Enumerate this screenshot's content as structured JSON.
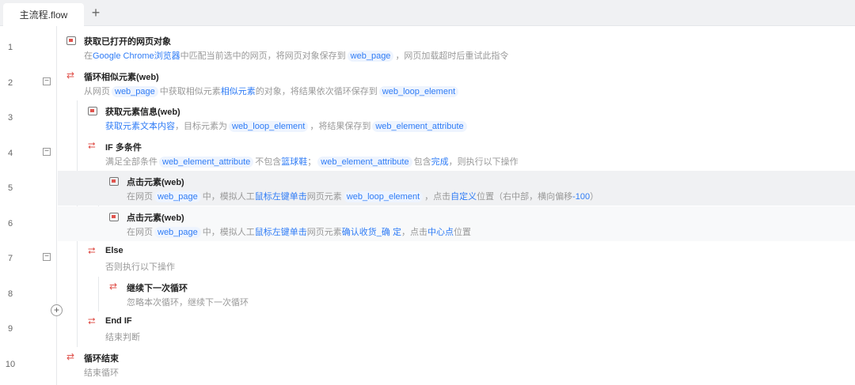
{
  "tab": {
    "label": "主流程.flow",
    "add": "+"
  },
  "line_numbers": [
    "1",
    "2",
    "3",
    "4",
    "5",
    "6",
    "7",
    "8",
    "9",
    "10"
  ],
  "collapse_symbol": "−",
  "add_step": "+",
  "rows": [
    {
      "level": 0,
      "icon": "browser-icon",
      "title": "获取已打开的网页对象",
      "desc": [
        [
          "在",
          ""
        ],
        [
          "Google Chrome浏览器",
          "h"
        ],
        [
          "中匹配当前选中的网页，将网页对象保存到",
          ""
        ],
        [
          "web_page",
          "v"
        ],
        [
          "，网页加载超时后重试此指令",
          ""
        ]
      ]
    },
    {
      "level": 0,
      "icon": "loop-icon",
      "title": "循环相似元素(web)",
      "desc": [
        [
          "从网页",
          ""
        ],
        [
          "web_page",
          "v"
        ],
        [
          "中获取相似元素",
          ""
        ],
        [
          "相似元素",
          "h"
        ],
        [
          "的对象，将结果依次循环保存到",
          ""
        ],
        [
          "web_loop_element",
          "v"
        ]
      ]
    },
    {
      "level": 1,
      "icon": "element-info-icon",
      "title": "获取元素信息(web)",
      "desc": [
        [
          "获取元素文本内容",
          "h"
        ],
        [
          "，目标元素为",
          ""
        ],
        [
          "web_loop_element",
          "v"
        ],
        [
          "，将结果保存到",
          ""
        ],
        [
          "web_element_attribute",
          "v"
        ]
      ]
    },
    {
      "level": 1,
      "icon": "if-icon",
      "title": "IF 多条件",
      "desc": [
        [
          "满足全部条件",
          ""
        ],
        [
          "web_element_attribute",
          "v"
        ],
        [
          "不包含",
          ""
        ],
        [
          "篮球鞋",
          "h"
        ],
        [
          "；",
          ""
        ],
        [
          "web_element_attribute",
          "v"
        ],
        [
          "包含",
          ""
        ],
        [
          "完成",
          "h"
        ],
        [
          "，则执行以下操作",
          ""
        ]
      ]
    },
    {
      "level": 2,
      "icon": "click-icon",
      "title": "点击元素(web)",
      "desc": [
        [
          "在网页",
          ""
        ],
        [
          "web_page",
          "v"
        ],
        [
          "中，模拟人工",
          ""
        ],
        [
          "鼠标左键单击",
          "h"
        ],
        [
          "网页元素",
          ""
        ],
        [
          "web_loop_element",
          "v"
        ],
        [
          "，点击",
          ""
        ],
        [
          "自定义",
          "h"
        ],
        [
          "位置（右中部，横向偏移",
          ""
        ],
        [
          "-100",
          "h"
        ],
        [
          "）",
          ""
        ]
      ]
    },
    {
      "level": 2,
      "icon": "click-icon",
      "title": "点击元素(web)",
      "desc": [
        [
          "在网页",
          ""
        ],
        [
          "web_page",
          "v"
        ],
        [
          "中，模拟人工",
          ""
        ],
        [
          "鼠标左键单击",
          "h"
        ],
        [
          "网页元素",
          ""
        ],
        [
          "确认收货_确 定",
          "h"
        ],
        [
          "，点击",
          ""
        ],
        [
          "中心点",
          "h"
        ],
        [
          "位置",
          ""
        ]
      ]
    },
    {
      "level": 1,
      "icon": "else-icon",
      "title": "Else",
      "desc": [
        [
          "否则执行以下操作",
          ""
        ]
      ]
    },
    {
      "level": 2,
      "icon": "continue-loop-icon",
      "title": "继续下一次循环",
      "desc": [
        [
          "忽略本次循环，继续下一次循环",
          ""
        ]
      ]
    },
    {
      "level": 1,
      "icon": "end-if-icon",
      "title": "End IF",
      "desc": [
        [
          "结束判断",
          ""
        ]
      ]
    },
    {
      "level": 0,
      "icon": "loop-end-icon",
      "title": "循环结束",
      "desc": [
        [
          "结束循环",
          ""
        ]
      ]
    }
  ]
}
